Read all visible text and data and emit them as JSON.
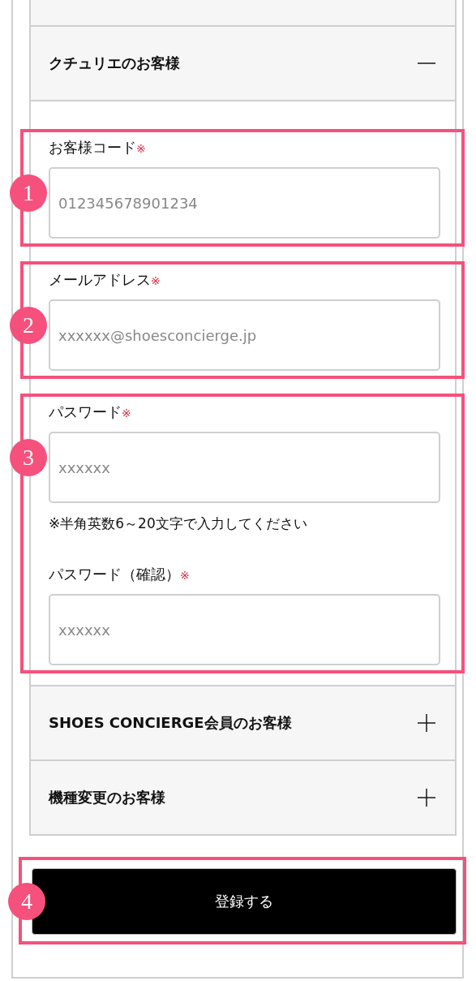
{
  "accordion": [
    {
      "title": "クチュリエのお客様",
      "expanded": true,
      "groups": [
        {
          "number": "1",
          "items": [
            {
              "kind": "field",
              "label": "お客様コード",
              "required_mark": "※",
              "placeholder": "012345678901234"
            }
          ]
        },
        {
          "number": "2",
          "items": [
            {
              "kind": "field",
              "label": "メールアドレス",
              "required_mark": "※",
              "placeholder": "xxxxxx@shoesconcierge.jp"
            }
          ]
        },
        {
          "number": "3",
          "items": [
            {
              "kind": "field",
              "label": "パスワード",
              "required_mark": "※",
              "placeholder": "xxxxxx"
            },
            {
              "kind": "note",
              "text": "※半角英数6～20文字で入力してください"
            },
            {
              "kind": "field",
              "label": "パスワード（確認）",
              "required_mark": "※",
              "placeholder": "xxxxxx"
            }
          ]
        }
      ]
    },
    {
      "title": "SHOES CONCIERGE会員のお客様",
      "expanded": false
    },
    {
      "title": "機種変更のお客様",
      "expanded": false
    }
  ],
  "submit": {
    "label": "登録する",
    "number": "4"
  }
}
